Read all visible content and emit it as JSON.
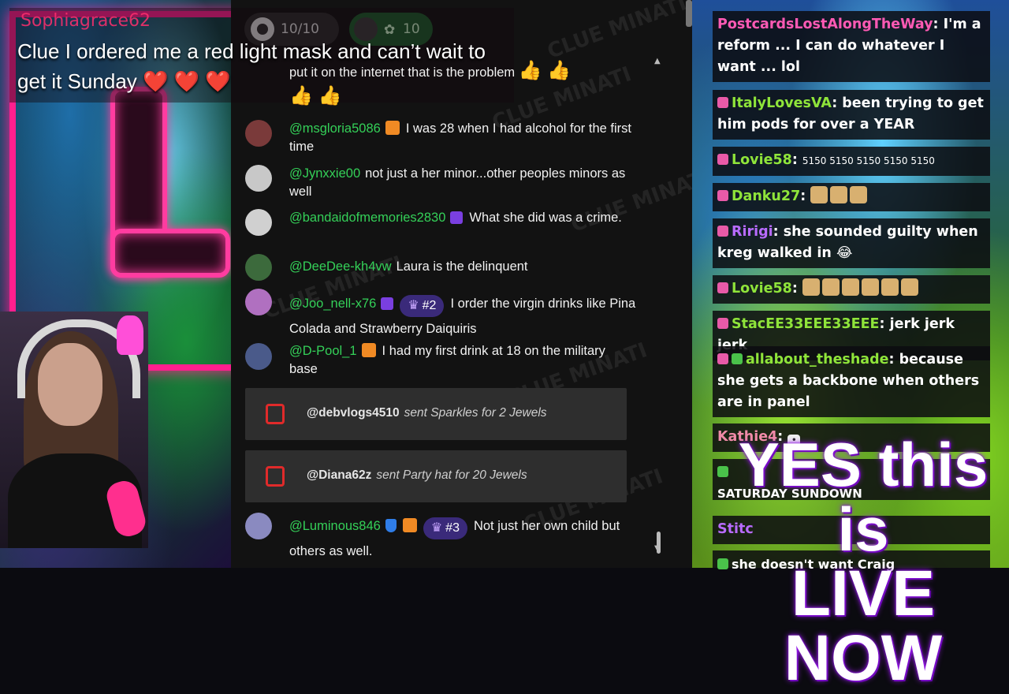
{
  "banner": {
    "username": "Sophiagrace62",
    "message": "Clue I ordered me a red light mask and can’t wait to get it Sunday",
    "hearts": "❤️ ❤️ ❤️"
  },
  "top_counters": {
    "goal": "10/10",
    "viewers": "10"
  },
  "watermark": "CLUE MINATI",
  "chat": {
    "partial_message": "put it on the internet that is the problem",
    "partial_emojis": "👍 👍",
    "partial_emojis_2": "👍 👍",
    "messages": [
      {
        "user": "@msgloria5086",
        "text": "I was 28 when I had alcohol for the first time"
      },
      {
        "user": "@Jynxxie00",
        "text": "not just a her minor...other peoples minors as well"
      },
      {
        "user": "@bandaidofmemories2830",
        "text": "What she did was a crime."
      },
      {
        "user": "@DeeDee-kh4vw",
        "text": "Laura is the delinquent"
      },
      {
        "user": "@Joo_nell-x76",
        "rank": "#2",
        "text": "I order the virgin drinks like Pina Colada and Strawberry Daiquiris"
      },
      {
        "user": "@D-Pool_1",
        "text": "I had my first drink at 18 on the military base"
      },
      {
        "user": "@Luminous846",
        "rank": "#3",
        "text": "Not just her own child but others as well."
      }
    ],
    "gifts": [
      {
        "user": "@debvlogs4510",
        "text": "sent Sparkles for 2 Jewels"
      },
      {
        "user": "@Diana62z",
        "text": "sent Party hat for 20 Jewels"
      }
    ]
  },
  "right_chat": [
    {
      "user": "PostcardsLostAlongTheWay",
      "text": "I'm a reform ... I can do whatever I want ... lol"
    },
    {
      "user": "ItalyLovesVA",
      "text": "been trying to get him pods for over a YEAR"
    },
    {
      "user": "Lovie58",
      "text": "5150 5150 5150 5150 5150"
    },
    {
      "user": "Danku27",
      "text": ""
    },
    {
      "user": "Ririgi",
      "text": "she sounded guilty when kreg walked in 😂"
    },
    {
      "user": "Lovie58",
      "text": ""
    },
    {
      "user": "StacEE33EEE33EEE",
      "text": "jerk jerk jerk"
    },
    {
      "user": "allabout_theshade",
      "text": "because she gets a backbone when others are in panel"
    },
    {
      "user": "Kathie4",
      "text": ""
    },
    {
      "user": "",
      "text": "SATURDAY SUNDOWN"
    },
    {
      "user": "Stitc",
      "text": ""
    },
    {
      "user": "",
      "text": "she doesn't want Craig"
    }
  ],
  "live_banner": {
    "line1": "YES this is",
    "line2": "LIVE NOW"
  },
  "colors": {
    "username_green": "#34d058",
    "accent_pink": "#ff1f8e",
    "live_purple": "#a020f0"
  }
}
